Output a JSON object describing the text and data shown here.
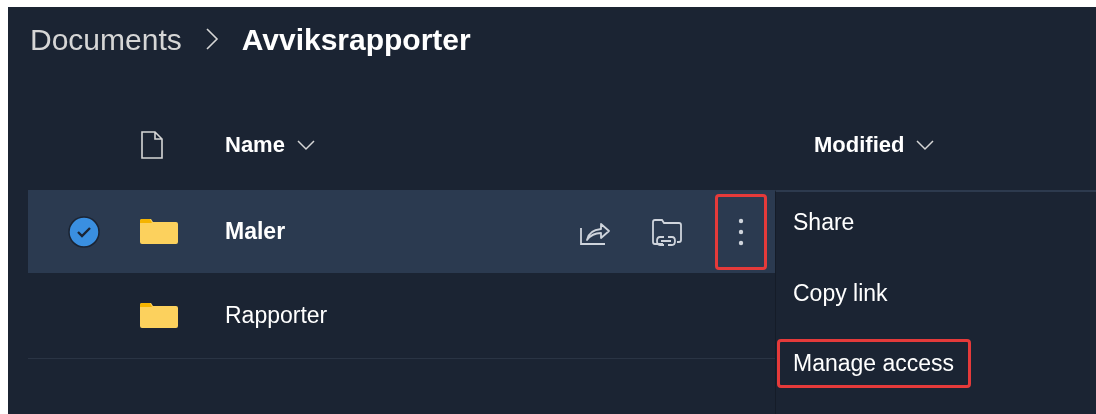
{
  "breadcrumb": [
    {
      "label": "Documents",
      "current": false
    },
    {
      "label": "Avviksrapporter",
      "current": true
    }
  ],
  "columns": [
    {
      "label": "Name"
    },
    {
      "label": "Modified"
    }
  ],
  "rows": [
    {
      "name": "Maler",
      "selected": true,
      "actions": [
        {
          "kind": "share"
        },
        {
          "kind": "link"
        },
        {
          "kind": "more",
          "highlighted": true
        }
      ]
    },
    {
      "name": "Rapporter",
      "selected": false,
      "actions": []
    }
  ],
  "context_menu": [
    {
      "label": "Share",
      "highlighted": false
    },
    {
      "label": "Copy link",
      "highlighted": false
    },
    {
      "label": "Manage access",
      "highlighted": true
    }
  ]
}
